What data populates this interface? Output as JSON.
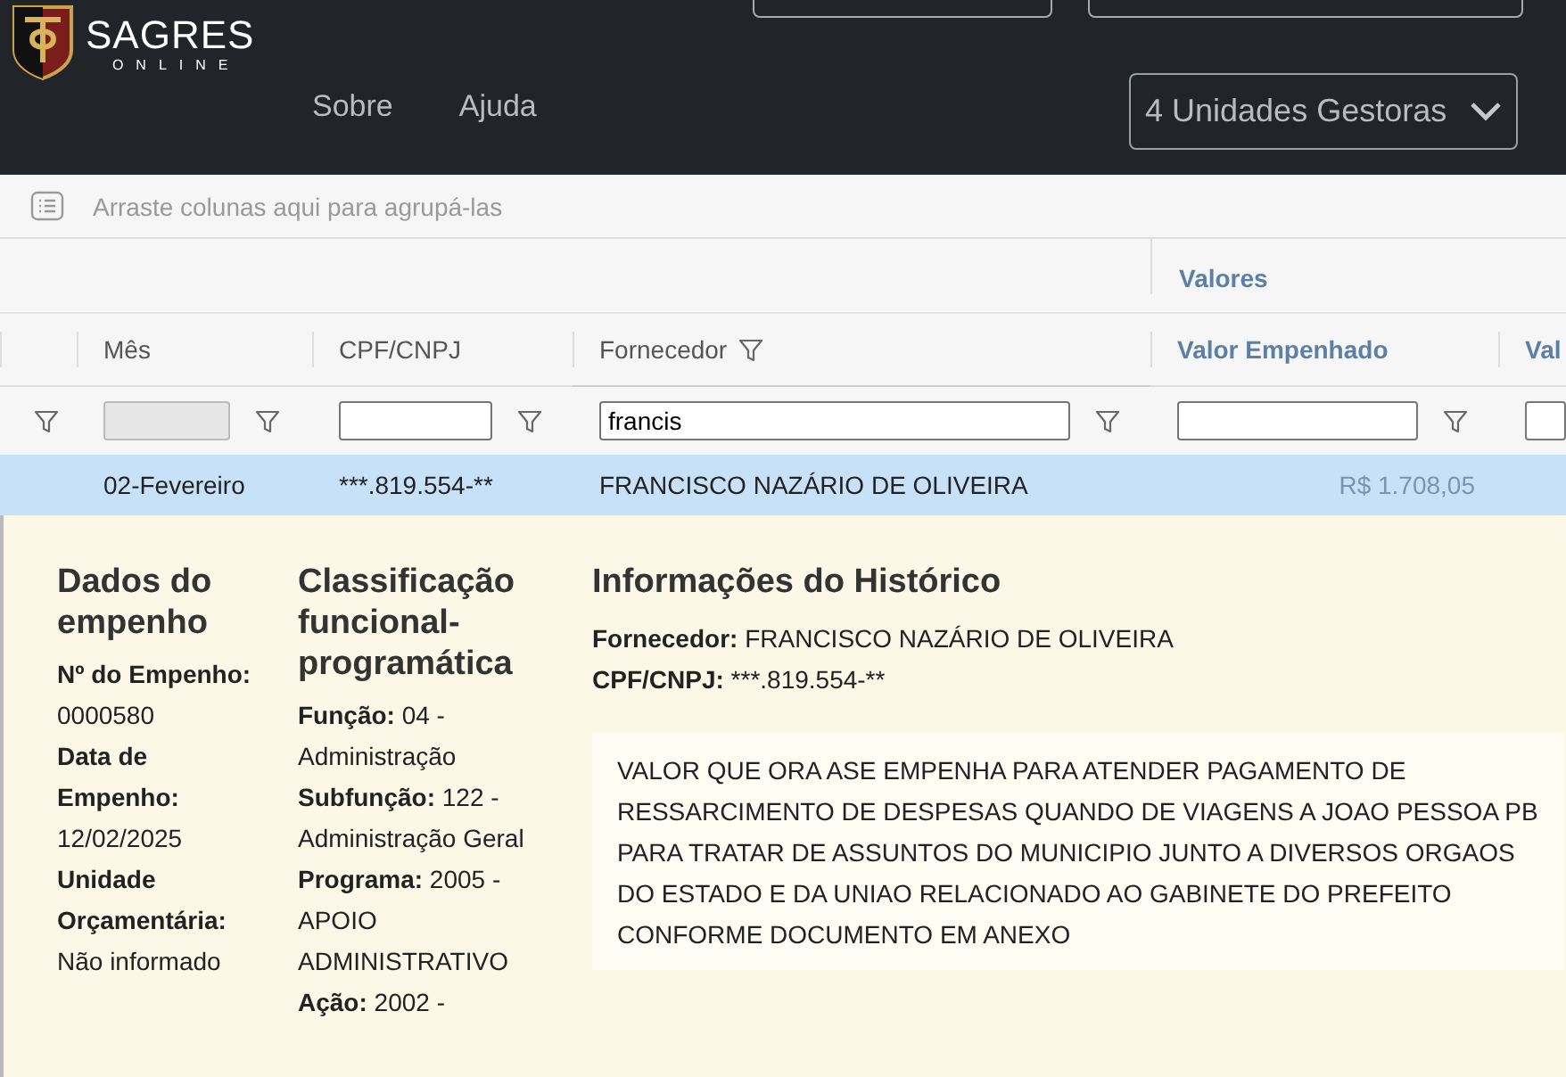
{
  "header": {
    "logo": {
      "name": "SAGRES",
      "sub": "ONLINE"
    },
    "nav": [
      "Sobre",
      "Ajuda"
    ],
    "unit_selector": "4 Unidades Gestoras"
  },
  "grid": {
    "group_panel_hint": "Arraste colunas aqui para agrupá-las",
    "band_label": "Valores",
    "columns": [
      {
        "kind": "plain",
        "filtered": false,
        "filter": {
          "kind": "icon"
        }
      },
      {
        "label": "Mês",
        "kind": "plain",
        "filtered": false,
        "filter": {
          "kind": "disabled"
        }
      },
      {
        "label": "CPF/CNPJ",
        "kind": "plain",
        "filtered": false,
        "filter": {
          "kind": "input"
        }
      },
      {
        "label": "Fornecedor",
        "kind": "plain",
        "filtered": true,
        "filter": {
          "kind": "input",
          "value": "francis"
        }
      },
      {
        "label": "Valor Empenhado",
        "kind": "value",
        "filtered": false,
        "filter": {
          "kind": "input"
        }
      },
      {
        "label": "Val",
        "kind": "value",
        "filtered": false,
        "filter": {
          "kind": "bare"
        }
      }
    ],
    "rows": [
      {
        "selected": true,
        "cells": [
          "",
          "02-Fevereiro",
          "***.819.554-**",
          "FRANCISCO NAZÁRIO DE OLIVEIRA",
          "R$ 1.708,05",
          ""
        ]
      }
    ]
  },
  "detail": {
    "sections": [
      {
        "title": "Dados do empenho",
        "fields": [
          {
            "label": "Nº do Empenho:",
            "value": "0000580"
          },
          {
            "label": "Data de Empenho:",
            "value": "12/02/2025"
          },
          {
            "label": "Unidade Orçamentária:",
            "value": "Não informado"
          }
        ]
      },
      {
        "title": "Classificação funcional-programática",
        "fields": [
          {
            "label": "Função:",
            "value": "04 - Administração"
          },
          {
            "label": "Subfunção:",
            "value": "122 - Administração Geral"
          },
          {
            "label": "Programa:",
            "value": "2005 - APOIO ADMINISTRATIVO"
          },
          {
            "label": "Ação:",
            "value": "2002 -"
          }
        ]
      },
      {
        "title": "Informações do Histórico",
        "fields": [
          {
            "label": "Fornecedor:",
            "value": "FRANCISCO NAZÁRIO DE OLIVEIRA"
          },
          {
            "label": "CPF/CNPJ:",
            "value": "***.819.554-**"
          }
        ],
        "note": "VALOR QUE ORA ASE EMPENHA PARA ATENDER PAGAMENTO DE RESSARCIMENTO DE DESPESAS QUANDO DE VIAGENS A JOAO PESSOA PB PARA TRATAR DE ASSUNTOS DO MUNICIPIO JUNTO A DIVERSOS ORGAOS DO ESTADO E DA UNIAO RELACIONADO AO GABINETE DO PREFEITO CONFORME DOCUMENTO EM ANEXO"
      }
    ]
  }
}
